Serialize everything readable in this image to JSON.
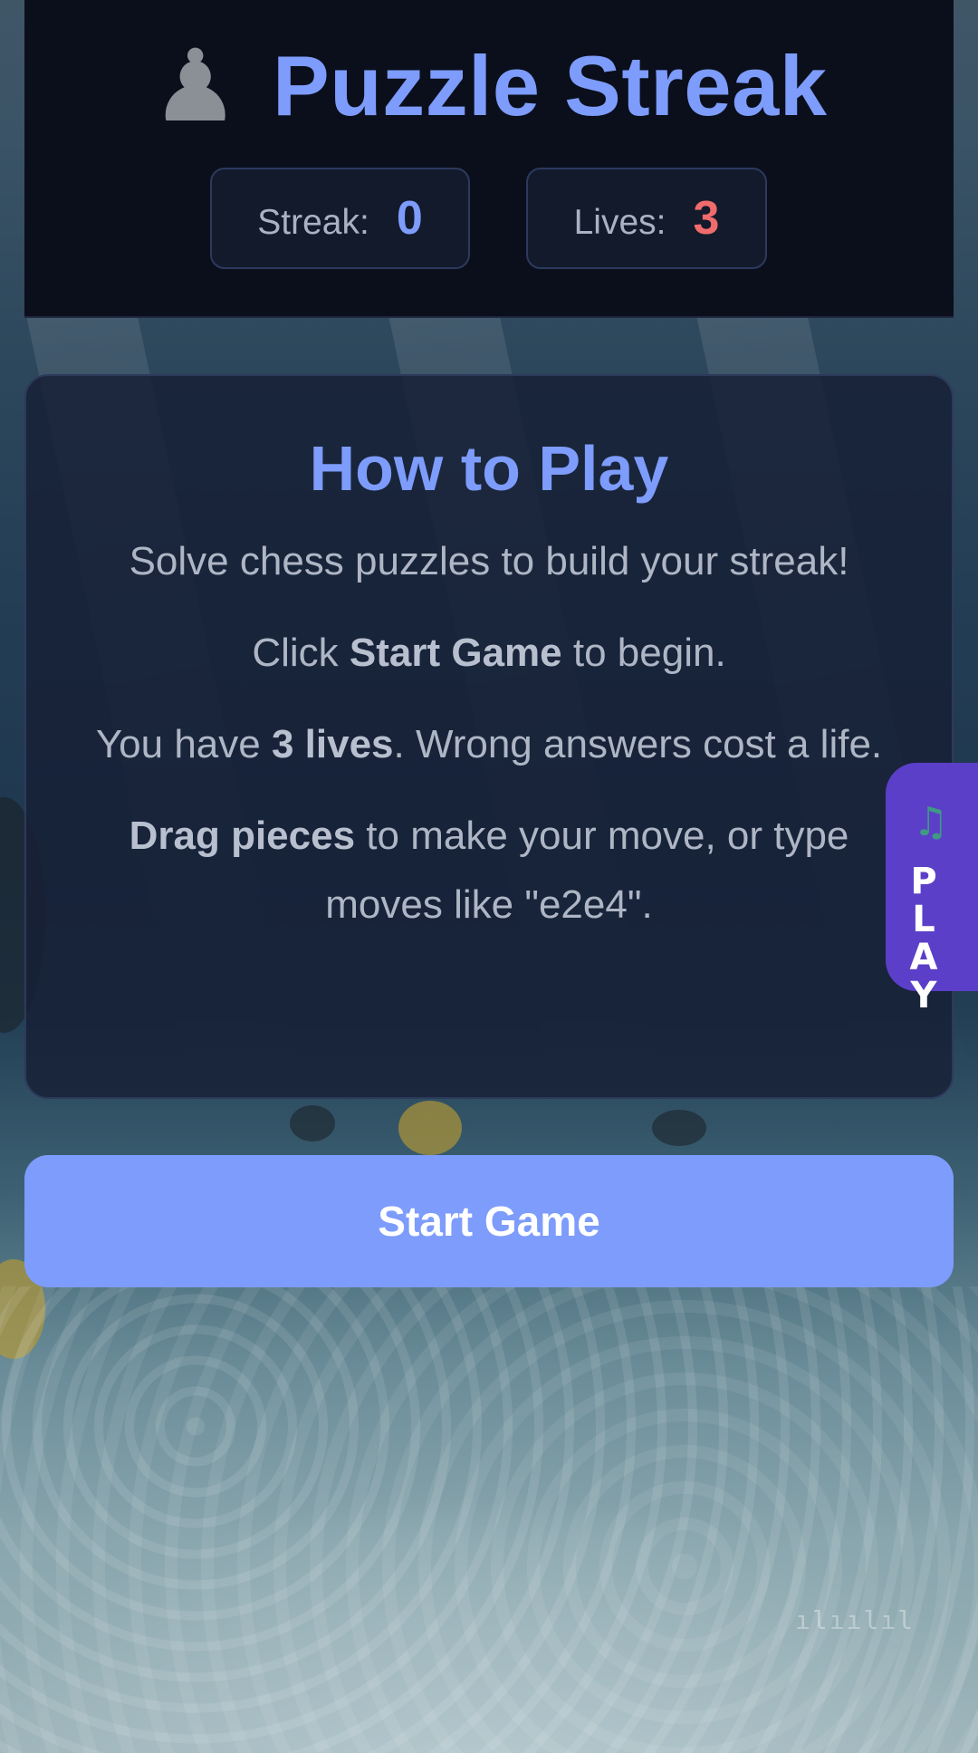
{
  "header": {
    "title": "Puzzle Streak",
    "icon": "pawn-icon",
    "stats": {
      "streak_label": "Streak:",
      "streak_value": "0",
      "lives_label": "Lives:",
      "lives_value": "3"
    }
  },
  "how_to_play": {
    "heading": "How to Play",
    "line1": "Solve chess puzzles to build your streak!",
    "line2_pre": "Click ",
    "line2_bold": "Start Game",
    "line2_post": " to begin.",
    "line3_pre": "You have ",
    "line3_bold": "3 lives",
    "line3_post": ". Wrong answers cost a life.",
    "line4_bold": "Drag pieces",
    "line4_post": " to make your move, or type moves like \"e2e4\"."
  },
  "start_button": {
    "label": "Start Game"
  },
  "music_tab": {
    "icon": "music-note-icon",
    "label": "PLAY"
  },
  "colors": {
    "accent": "#7d9cfb",
    "lives": "#f06b6b",
    "header_bg": "#0b0f1c",
    "music_tab_bg": "#5b3fc8"
  }
}
